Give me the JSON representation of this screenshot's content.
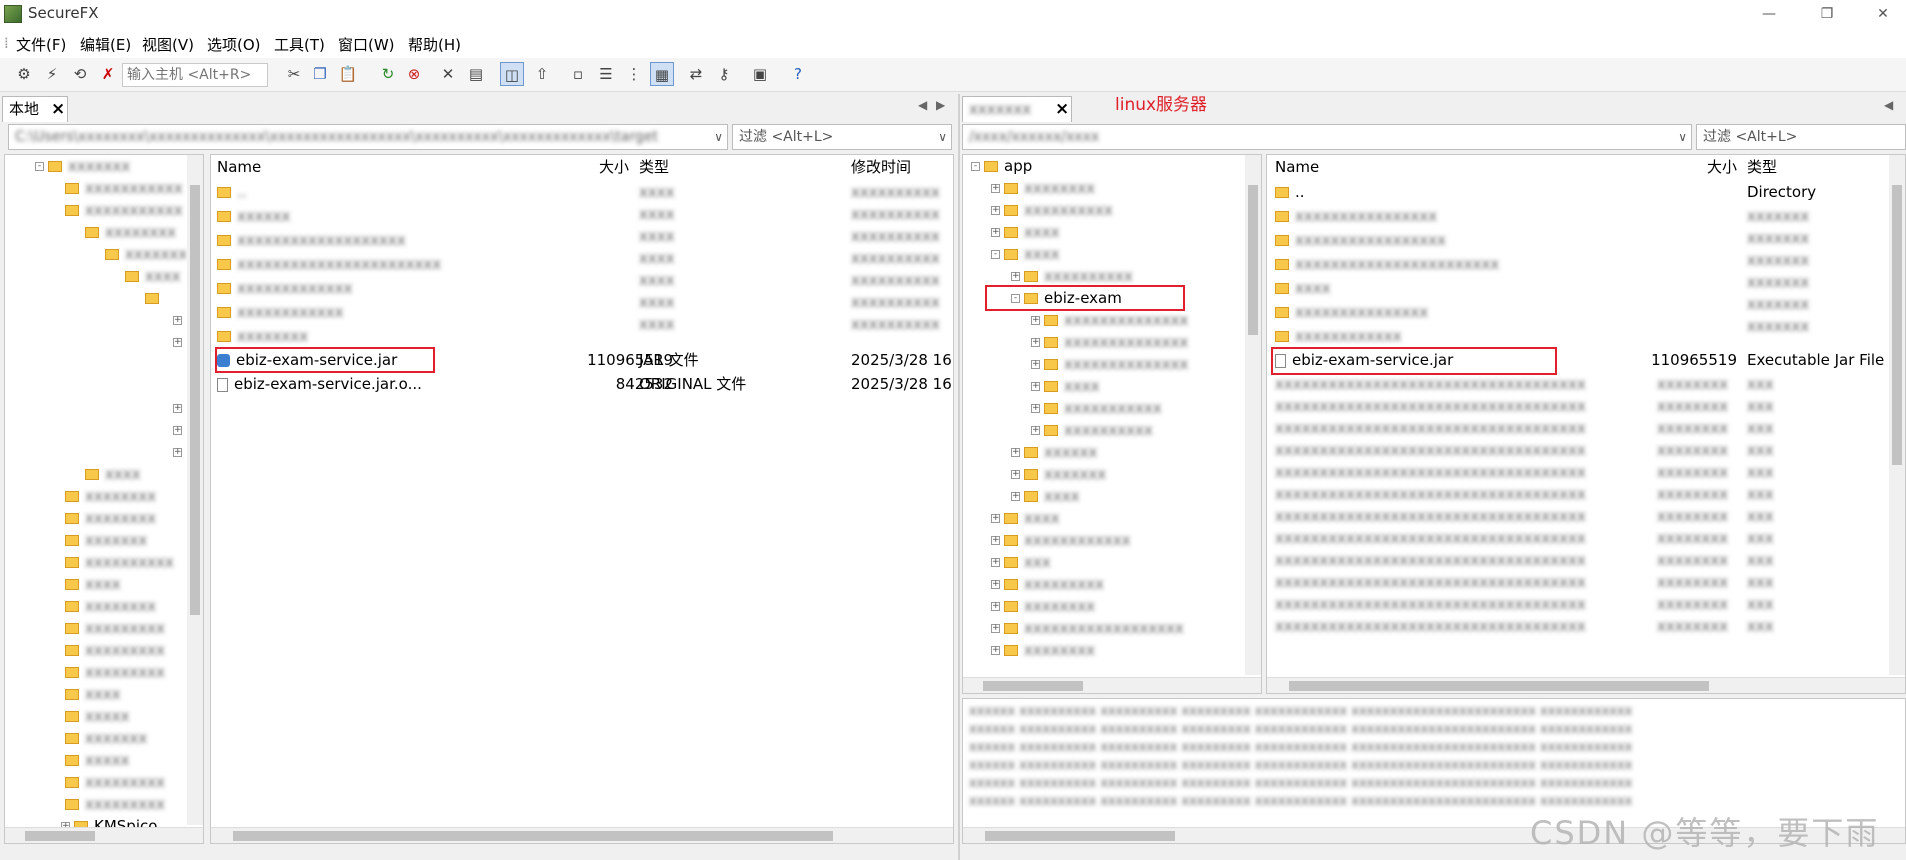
{
  "window": {
    "title": "SecureFX"
  },
  "menu": [
    "文件(F)",
    "编辑(E)",
    "视图(V)",
    "选项(O)",
    "工具(T)",
    "窗口(W)",
    "帮助(H)"
  ],
  "toolbar": {
    "host_placeholder": "输入主机 <Alt+R>"
  },
  "annotation": {
    "server_label": "linux服务器"
  },
  "watermark": "CSDN @等等，要下雨",
  "left": {
    "tab_label": "本地",
    "filter_placeholder": "过滤 <Alt+L>",
    "columns": {
      "name": "Name",
      "size": "大小",
      "type": "类型",
      "modified": "修改时间"
    },
    "files": [
      {
        "name": "ebiz-exam-service.jar",
        "size": "110965519",
        "type": "JAR 文件",
        "modified": "2025/3/28 16:"
      },
      {
        "name": "ebiz-exam-service.jar.o...",
        "size": "842532",
        "type": "ORIGINAL 文件",
        "modified": "2025/3/28 16:"
      }
    ],
    "tree_last": "KMSpico"
  },
  "right": {
    "filter_placeholder": "过滤 <Alt+L>",
    "tree": {
      "root": "app",
      "selected": "ebiz-exam"
    },
    "columns": {
      "name": "Name",
      "size": "大小",
      "type": "类型"
    },
    "parent_row": {
      "name": "..",
      "type": "Directory"
    },
    "files": [
      {
        "name": "ebiz-exam-service.jar",
        "size": "110965519",
        "type": "Executable Jar File"
      }
    ]
  }
}
